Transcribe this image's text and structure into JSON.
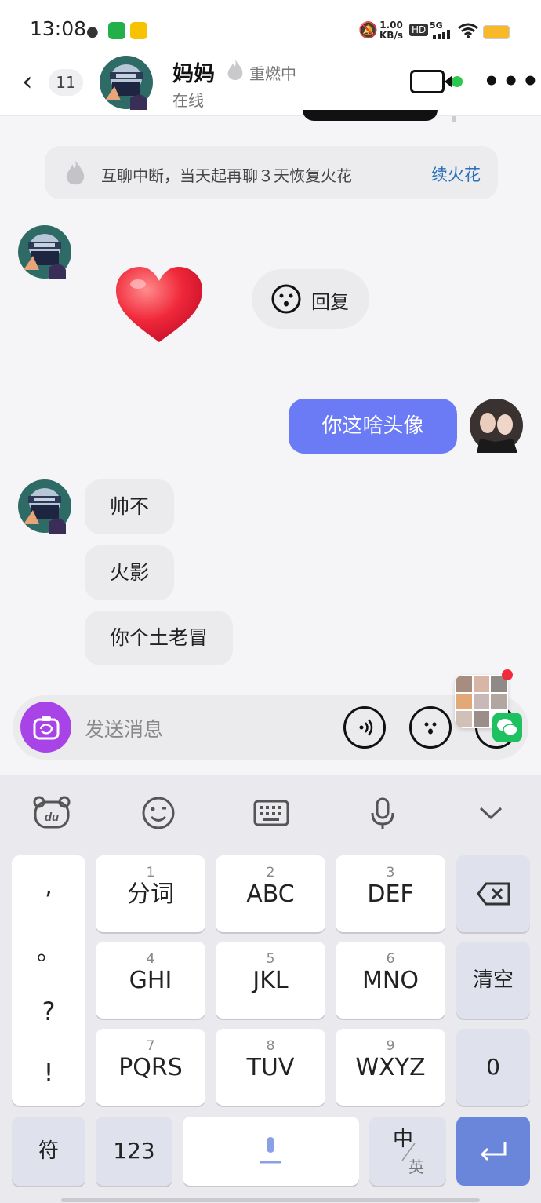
{
  "status_bar": {
    "time": "13:08",
    "net_speed_value": "1.00",
    "net_speed_unit": "KB/s",
    "hd": "HD",
    "network": "5G"
  },
  "header": {
    "unread_count": "11",
    "contact_name": "妈妈",
    "rekindle_label": "重燃中",
    "online_status": "在线"
  },
  "chat": {
    "system_note": "互聊中断，当天起再聊３天恢复火花",
    "system_link": "续火花",
    "reply_label": "回复",
    "messages": [
      {
        "from": "me",
        "text": "你这啥头像"
      },
      {
        "from": "them",
        "text": "帅不"
      },
      {
        "from": "them",
        "text": "火影"
      },
      {
        "from": "them",
        "text": "你个土老冒"
      }
    ]
  },
  "input": {
    "placeholder": "发送消息"
  },
  "keyboard": {
    "punct": [
      ",",
      "。",
      "?",
      "!"
    ],
    "row1": [
      {
        "num": "1",
        "label": "分词"
      },
      {
        "num": "2",
        "label": "ABC"
      },
      {
        "num": "3",
        "label": "DEF"
      }
    ],
    "row2": [
      {
        "num": "4",
        "label": "GHI"
      },
      {
        "num": "5",
        "label": "JKL"
      },
      {
        "num": "6",
        "label": "MNO"
      }
    ],
    "row3": [
      {
        "num": "7",
        "label": "PQRS"
      },
      {
        "num": "8",
        "label": "TUV"
      },
      {
        "num": "9",
        "label": "WXYZ"
      }
    ],
    "clear_label": "清空",
    "zero_label": "0",
    "symbol_label": "符",
    "numbers_label": "123",
    "lang_top": "中",
    "lang_bottom": "英"
  },
  "colors": {
    "accent": "#6b7bf5",
    "camera": "#a843e8",
    "online_dot": "#2bc84d",
    "link": "#2a70b8",
    "enter": "#6a86db"
  }
}
